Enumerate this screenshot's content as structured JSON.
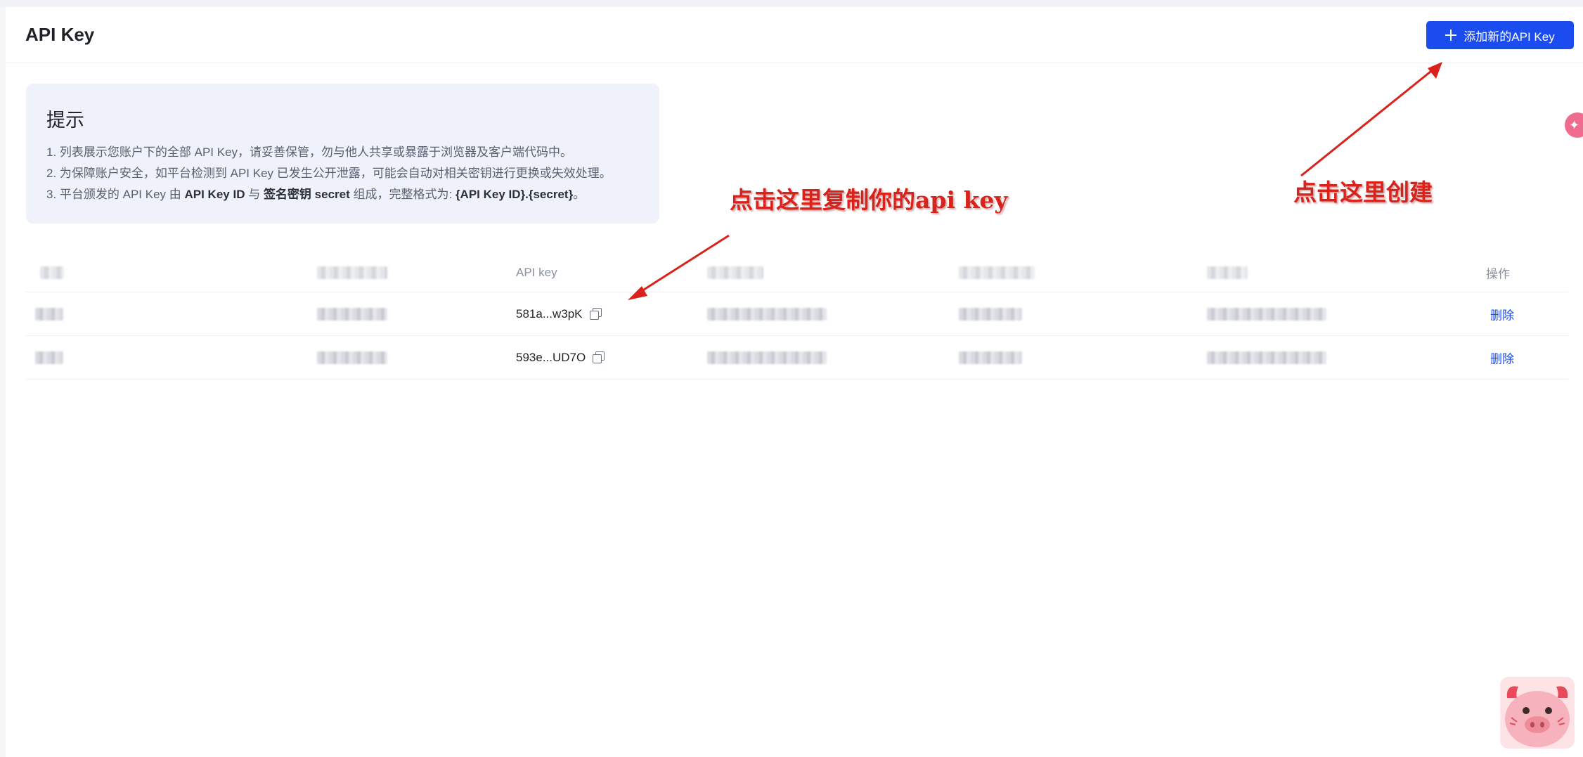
{
  "header": {
    "title": "API Key",
    "add_button_label": "添加新的API Key"
  },
  "tips": {
    "title": "提示",
    "line1": "1. 列表展示您账户下的全部 API Key，请妥善保管，勿与他人共享或暴露于浏览器及客户端代码中。",
    "line2": "2. 为保障账户安全，如平台检测到 API Key 已发生公开泄露，可能会自动对相关密钥进行更换或失效处理。",
    "line3": {
      "p1": "3. 平台颁发的 API Key 由 ",
      "b1": "API Key ID",
      "p2": " 与 ",
      "b2": "签名密钥 secret",
      "p3": " 组成，完整格式为: ",
      "b3": "{API Key ID}.{secret}",
      "p4": "。"
    }
  },
  "table": {
    "columns": {
      "api_key": "API key",
      "actions": "操作"
    },
    "rows": [
      {
        "api_key": "581a...w3pK",
        "action_label": "删除"
      },
      {
        "api_key": "593e...UD7O",
        "action_label": "删除"
      }
    ]
  },
  "annotations": {
    "copy_hint": "点击这里复制你的api key",
    "create_hint": "点击这里创建"
  },
  "colors": {
    "primary": "#1b4cf0",
    "annotation": "#d9221b",
    "tip_background": "#eff2fa"
  },
  "icons": {
    "add": "plus-icon",
    "copy": "copy-icon"
  }
}
